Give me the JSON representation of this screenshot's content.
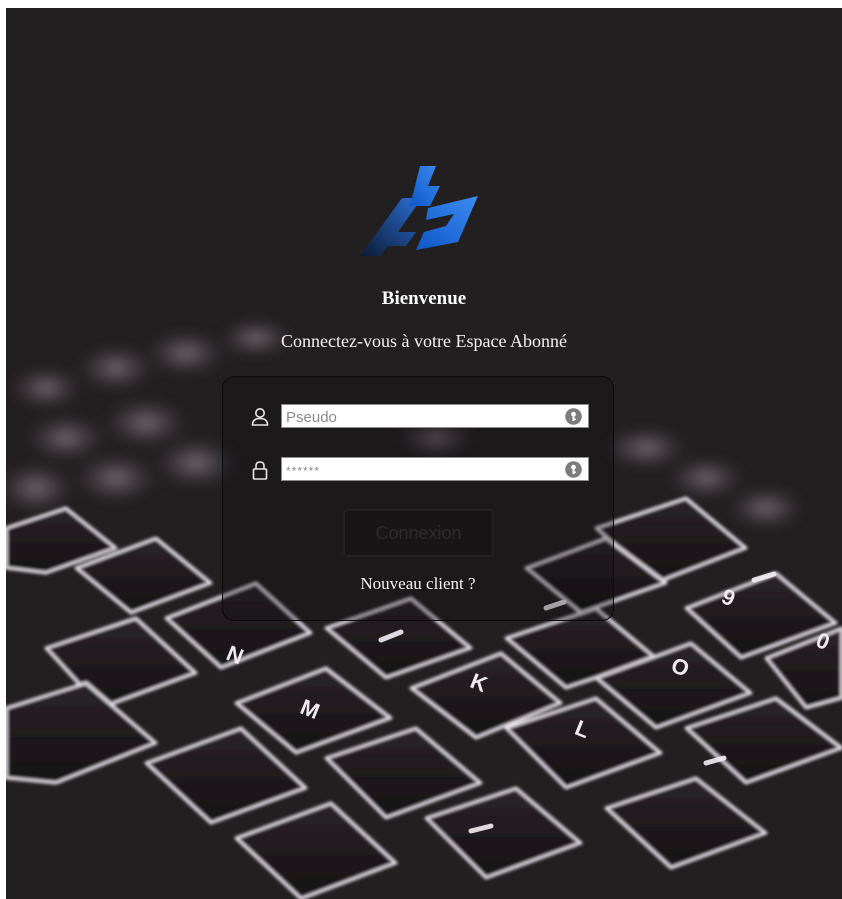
{
  "header": {
    "welcome": "Bienvenue",
    "subtitle": "Connectez-vous à votre Espace Abonné"
  },
  "form": {
    "username_placeholder": "Pseudo",
    "password_placeholder": "******",
    "submit_label": "Connexion",
    "new_client_label": "Nouveau client ?"
  },
  "icons": {
    "logo": "brand-logo",
    "user": "user-icon",
    "lock": "lock-icon",
    "key": "key-badge-icon"
  },
  "colors": {
    "background": "#221f20",
    "logo_blue": "#1d6fe0",
    "text": "#ffffff"
  },
  "keyboard_keys": [
    "N",
    "M",
    "K",
    "L",
    "O",
    "9",
    "0"
  ]
}
